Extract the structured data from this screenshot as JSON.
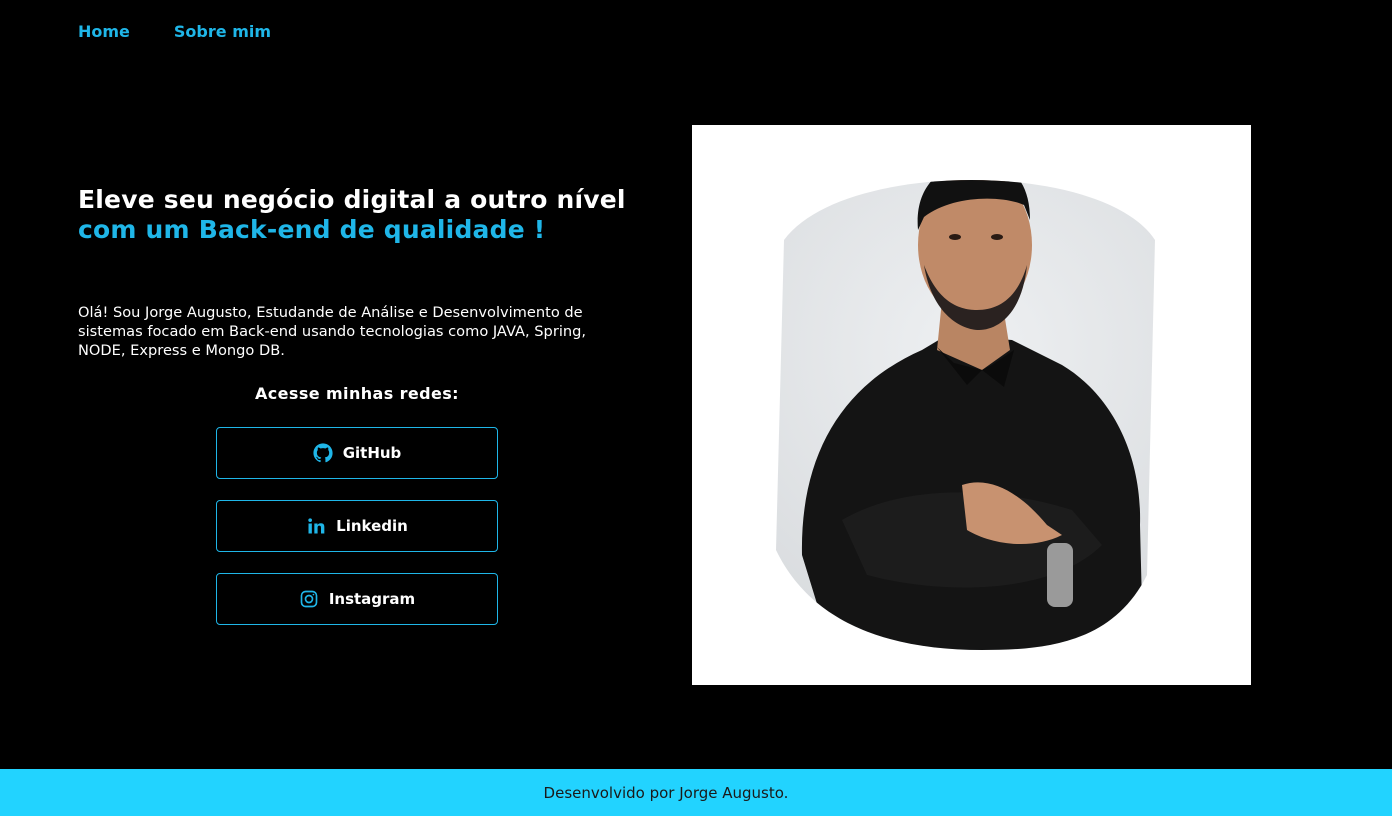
{
  "nav": {
    "home": "Home",
    "about": "Sobre mim"
  },
  "hero": {
    "headline_white": "Eleve seu negócio digital a outro nível ",
    "headline_accent": "com um Back-end de qualidade !",
    "intro": "Olá! Sou Jorge Augusto, Estudande de Análise e Desenvolvimento de sistemas focado em Back-end usando tecnologias como JAVA, Spring, NODE, Express e Mongo DB.",
    "networks_title": "Acesse minhas redes:"
  },
  "social": [
    {
      "label": "GitHub",
      "icon": "github-icon"
    },
    {
      "label": "Linkedin",
      "icon": "linkedin-icon"
    },
    {
      "label": "Instagram",
      "icon": "instagram-icon"
    }
  ],
  "footer": {
    "text": "Desenvolvido por Jorge Augusto."
  },
  "colors": {
    "accent": "#1fb6e8",
    "background": "#000000",
    "footer_bg": "#22d3ff"
  }
}
